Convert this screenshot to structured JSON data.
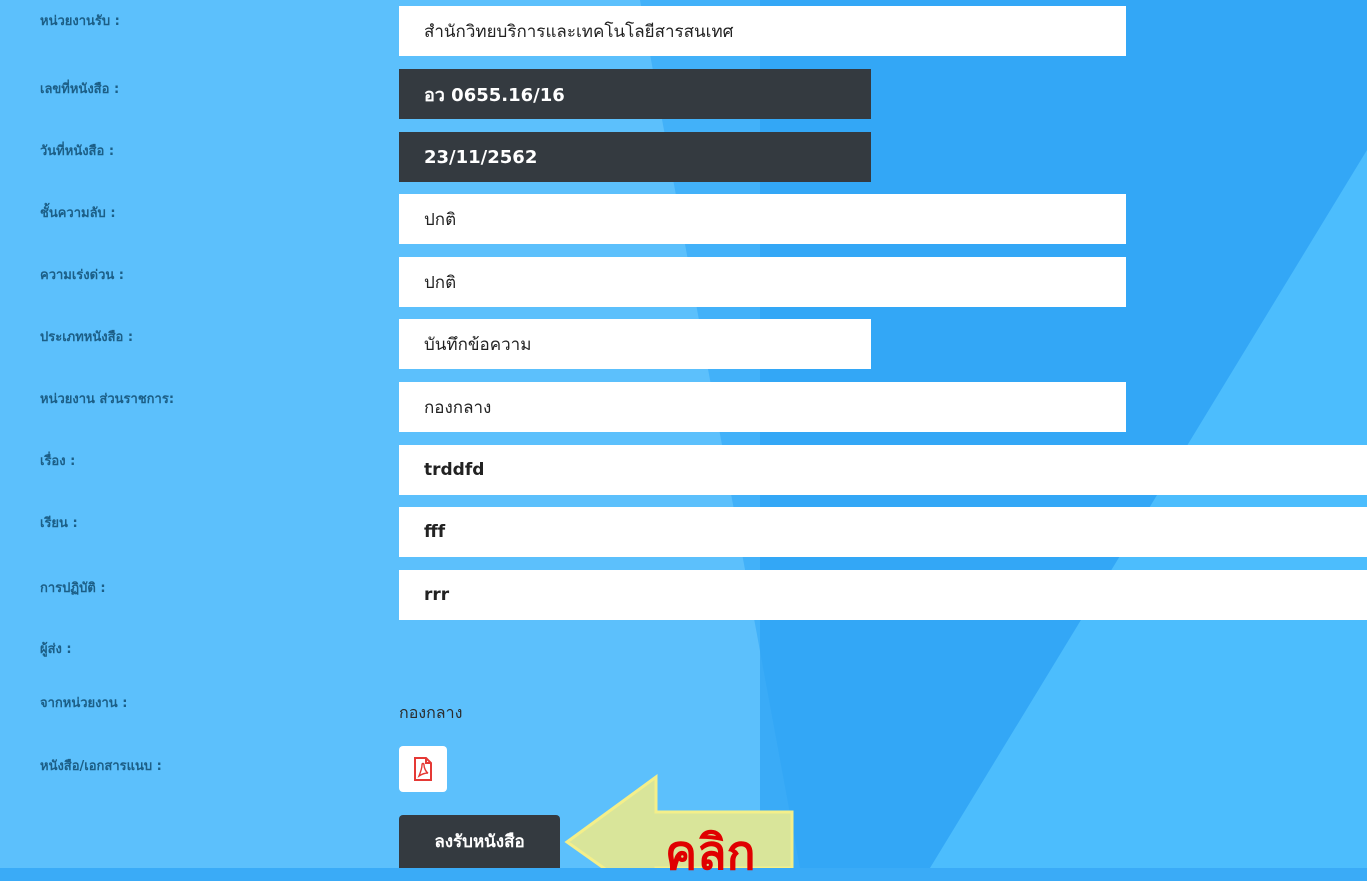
{
  "fields": [
    {
      "label": "หน่วยงานรับ :",
      "value": "สำนักวิทยบริการและเทคโนโลยีสารสนเทศ"
    },
    {
      "label": "เลขที่หนังสือ :",
      "value": "อว 0655.16/16"
    },
    {
      "label": "วันที่หนังสือ :",
      "value": "23/11/2562"
    },
    {
      "label": "ชั้นความลับ :",
      "value": "ปกติ"
    },
    {
      "label": "ความเร่งด่วน :",
      "value": "ปกติ"
    },
    {
      "label": "ประเภทหนังสือ :",
      "value": "บันทึกข้อความ"
    },
    {
      "label": "หน่วยงาน ส่วนราชการ:",
      "value": "กองกลาง"
    },
    {
      "label": "เรื่อง :",
      "value": "trddfd"
    },
    {
      "label": "เรียน :",
      "value": "fff"
    },
    {
      "label": "การปฏิบัติ :",
      "value": "rrr"
    }
  ],
  "sender": {
    "label": "ผู้ส่ง :"
  },
  "from_unit": {
    "label": "จากหน่วยงาน :",
    "value": "กองกลาง"
  },
  "attachment": {
    "label": "หนังสือ/เอกสารแนบ :",
    "icon": "pdf-icon"
  },
  "submit_label": "ลงรับหนังสือ",
  "callout_text": "คลิก",
  "colors": {
    "dark_field": "#343a40",
    "label": "#1c5e86",
    "arrow": "#d9e59a",
    "callout": "#e00000",
    "pdf_icon": "#e53935"
  }
}
